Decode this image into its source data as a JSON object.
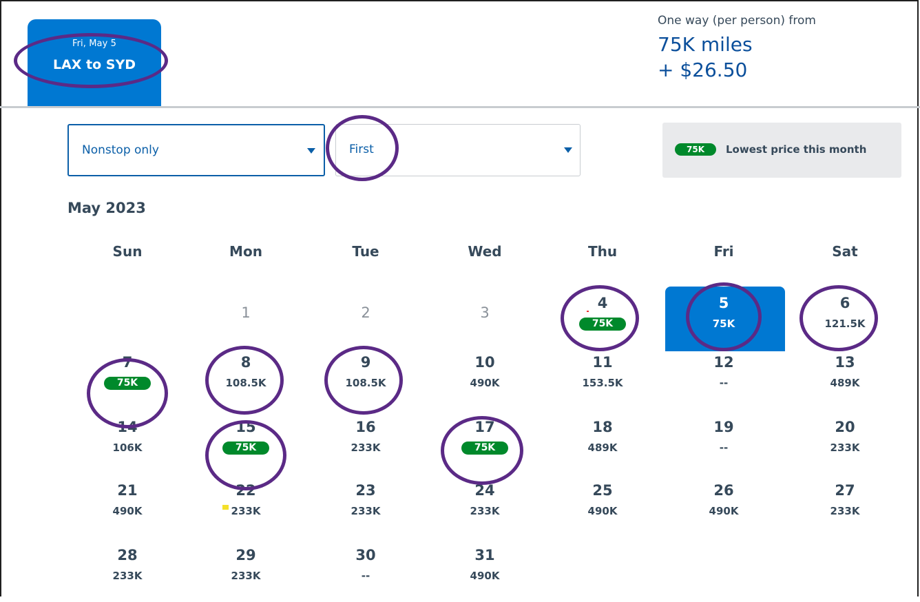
{
  "trip": {
    "date": "Fri, May 5",
    "route": "LAX to SYD"
  },
  "fare": {
    "label": "One way (per person) from",
    "miles": "75K miles",
    "cash": "+ $26.50"
  },
  "filters": {
    "stops": "Nonstop only",
    "cabin": "First"
  },
  "legend": {
    "pill": "75K",
    "text": "Lowest price this month"
  },
  "calendar": {
    "month": "May 2023",
    "weekdays": [
      "Sun",
      "Mon",
      "Tue",
      "Wed",
      "Thu",
      "Fri",
      "Sat"
    ],
    "days": [
      {
        "day": "1",
        "price": "",
        "lowest": false,
        "available": false
      },
      {
        "day": "2",
        "price": "",
        "lowest": false,
        "available": false
      },
      {
        "day": "3",
        "price": "",
        "lowest": false,
        "available": false
      },
      {
        "day": "4",
        "price": "75K",
        "lowest": true,
        "available": true
      },
      {
        "day": "5",
        "price": "75K",
        "lowest": false,
        "available": true,
        "selected": true
      },
      {
        "day": "6",
        "price": "121.5K",
        "lowest": false,
        "available": true
      },
      {
        "day": "7",
        "price": "75K",
        "lowest": true,
        "available": true
      },
      {
        "day": "8",
        "price": "108.5K",
        "lowest": false,
        "available": true
      },
      {
        "day": "9",
        "price": "108.5K",
        "lowest": false,
        "available": true
      },
      {
        "day": "10",
        "price": "490K",
        "lowest": false,
        "available": true
      },
      {
        "day": "11",
        "price": "153.5K",
        "lowest": false,
        "available": true
      },
      {
        "day": "12",
        "price": "--",
        "lowest": false,
        "available": true
      },
      {
        "day": "13",
        "price": "489K",
        "lowest": false,
        "available": true
      },
      {
        "day": "14",
        "price": "106K",
        "lowest": false,
        "available": true
      },
      {
        "day": "15",
        "price": "75K",
        "lowest": true,
        "available": true
      },
      {
        "day": "16",
        "price": "233K",
        "lowest": false,
        "available": true
      },
      {
        "day": "17",
        "price": "75K",
        "lowest": true,
        "available": true
      },
      {
        "day": "18",
        "price": "489K",
        "lowest": false,
        "available": true
      },
      {
        "day": "19",
        "price": "--",
        "lowest": false,
        "available": true
      },
      {
        "day": "20",
        "price": "233K",
        "lowest": false,
        "available": true
      },
      {
        "day": "21",
        "price": "490K",
        "lowest": false,
        "available": true
      },
      {
        "day": "22",
        "price": "233K",
        "lowest": false,
        "available": true
      },
      {
        "day": "23",
        "price": "233K",
        "lowest": false,
        "available": true
      },
      {
        "day": "24",
        "price": "233K",
        "lowest": false,
        "available": true
      },
      {
        "day": "25",
        "price": "490K",
        "lowest": false,
        "available": true
      },
      {
        "day": "26",
        "price": "490K",
        "lowest": false,
        "available": true
      },
      {
        "day": "27",
        "price": "233K",
        "lowest": false,
        "available": true
      },
      {
        "day": "28",
        "price": "233K",
        "lowest": false,
        "available": true
      },
      {
        "day": "29",
        "price": "233K",
        "lowest": false,
        "available": true
      },
      {
        "day": "30",
        "price": "--",
        "lowest": false,
        "available": true
      },
      {
        "day": "31",
        "price": "490K",
        "lowest": false,
        "available": true
      }
    ]
  },
  "colors": {
    "brand_blue": "#0078d2",
    "link_blue": "#0b5fa8",
    "lowest_green": "#00892b",
    "annotation_purple": "#5b2a86"
  }
}
